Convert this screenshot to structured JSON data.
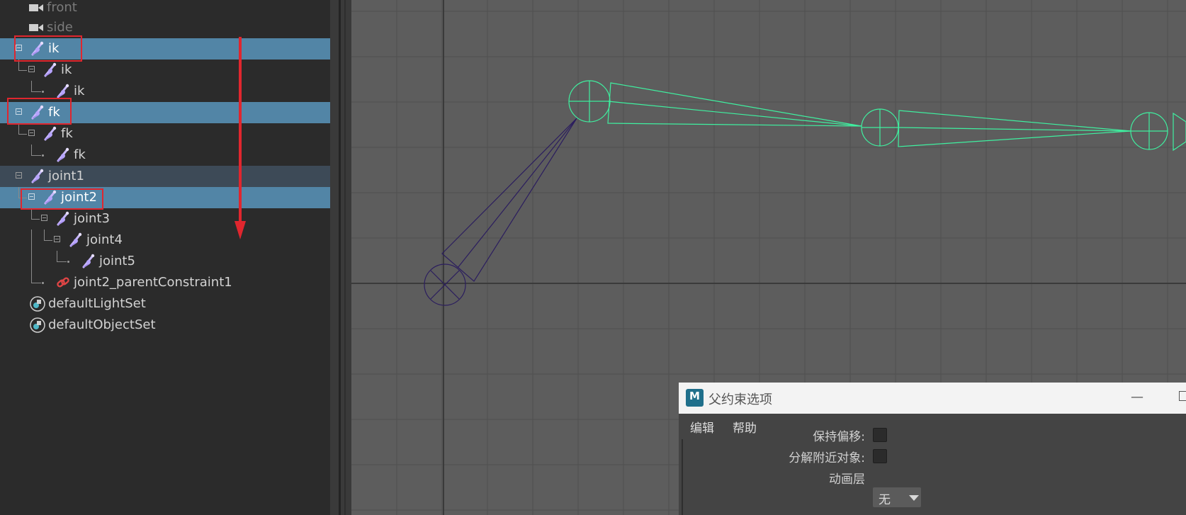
{
  "outliner": {
    "items": [
      {
        "label": "front"
      },
      {
        "label": "side"
      },
      {
        "label": "ik"
      },
      {
        "label": "ik"
      },
      {
        "label": "ik"
      },
      {
        "label": "fk"
      },
      {
        "label": "fk"
      },
      {
        "label": "fk"
      },
      {
        "label": "joint1"
      },
      {
        "label": "joint2"
      },
      {
        "label": "joint3"
      },
      {
        "label": "joint4"
      },
      {
        "label": "joint5"
      },
      {
        "label": "joint2_parentConstraint1"
      },
      {
        "label": "defaultLightSet"
      },
      {
        "label": "defaultObjectSet"
      }
    ]
  },
  "dialog": {
    "title": "父约束选项",
    "minimize": "—",
    "menu": [
      "编辑",
      "帮助"
    ],
    "options": {
      "maintain_offset": "保持偏移:",
      "decompose_target": "分解附近对象:",
      "anim_layer": "动画层",
      "anim_layer_value": "无"
    }
  },
  "colors": {
    "selection": "#5285a6",
    "highlight": "#3d4a57",
    "annotation_red": "#e0262e",
    "joint_green": "#3ff0a0",
    "joint_purple": "#3a2a6e"
  },
  "icons": [
    "camera-icon",
    "joint-icon",
    "constraint-icon",
    "set-icon",
    "maya-logo-icon"
  ]
}
